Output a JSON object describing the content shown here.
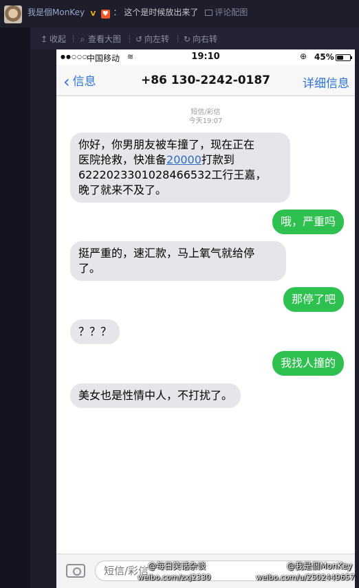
{
  "post": {
    "username": "我是個MonKey",
    "badge_v": "V",
    "badge_member": "♥",
    "colon": "：",
    "text": "这个是时候放出来了",
    "comment_link": "评论配图"
  },
  "toolbar": {
    "collapse": "收起",
    "view_large": "查看大图",
    "rotate_left": "向左转",
    "rotate_right": "向右转"
  },
  "phone": {
    "status": {
      "signal": "●●○○○",
      "carrier": "中国移动",
      "time": "19:10",
      "battery": "45%",
      "battery_level": 0.45
    },
    "nav": {
      "back": "信息",
      "contact": "+86 130-2242-0187",
      "details": "详细信息"
    },
    "meta": {
      "kind": "短信/彩信",
      "time": "今天19:07"
    },
    "messages": [
      {
        "direction": "incoming",
        "lines": [
          "你好，你男朋友被车撞了，现在正在",
          "医院抢救，快准备",
          "20000",
          "打款到",
          "6222023301028466532工行王嘉，",
          "晚了就来不及了。"
        ]
      },
      {
        "direction": "outgoing",
        "text": "哦，严重吗"
      },
      {
        "direction": "incoming",
        "lines": [
          "挺严重的，速汇款，马上氧气就给停",
          "了。"
        ]
      },
      {
        "direction": "outgoing",
        "text": "那停了吧"
      },
      {
        "direction": "incoming",
        "text": "？？？"
      },
      {
        "direction": "outgoing",
        "text": "我找人撞的"
      },
      {
        "direction": "incoming",
        "text": "美女也是性情中人，不打扰了。"
      }
    ],
    "input_placeholder": "短信/彩信"
  },
  "watermarks": {
    "left_top": "@每日笑话杂谈",
    "left_bottom": "weibo.com/zxj2330",
    "right_top": "@我是個MonKey",
    "right_bottom": "weibo.com/u/2502449657"
  }
}
